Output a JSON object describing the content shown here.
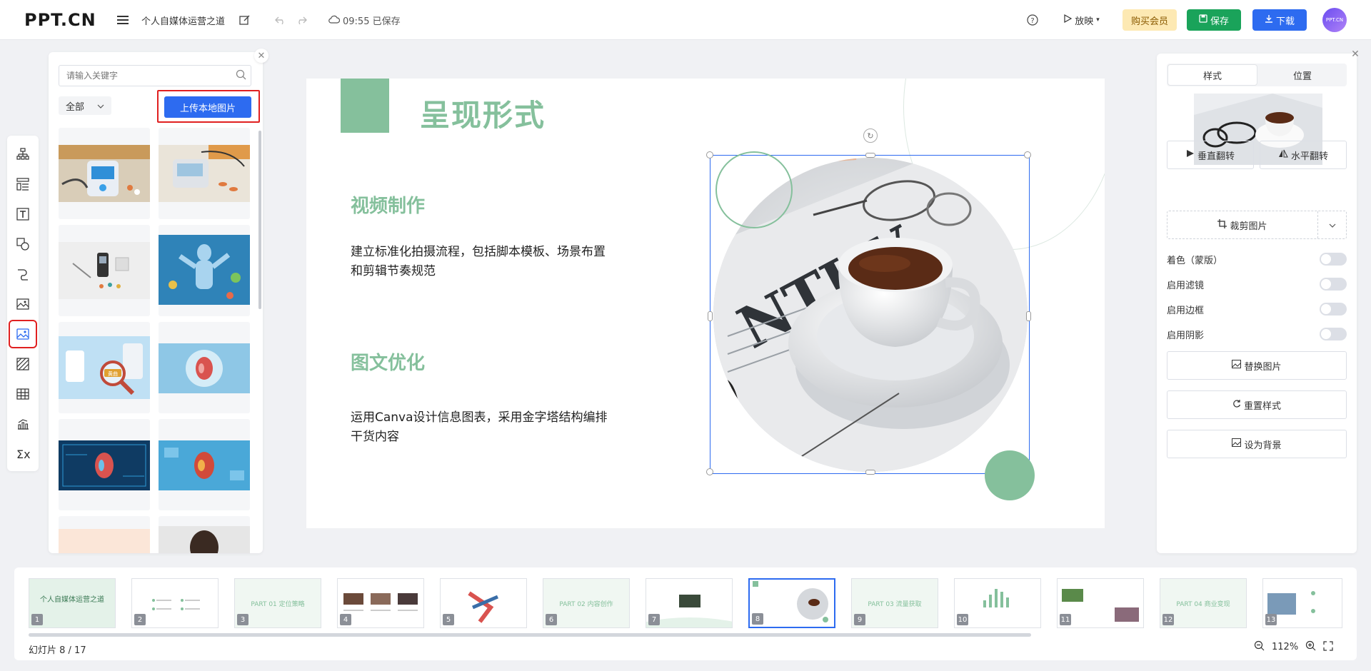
{
  "topbar": {
    "logo": "PPT.CN",
    "doc_title": "个人自媒体运营之道",
    "save_status": "09:55 已保存",
    "play_label": "放映",
    "vip_label": "购买会员",
    "save_label": "保存",
    "download_label": "下载",
    "avatar_text": "PPT.CN"
  },
  "image_panel": {
    "search_placeholder": "请输入关键字",
    "filter_label": "全部",
    "upload_label": "上传本地图片",
    "thumb_badge": "黄曲"
  },
  "slide": {
    "title": "呈现形式",
    "sections": [
      {
        "heading": "视频制作",
        "text": "建立标准化拍摄流程，包括脚本模板、场景布置和剪辑节奏规范"
      },
      {
        "heading": "图文优化",
        "text": "运用Canva设计信息图表，采用金字塔结构编排干货内容"
      }
    ],
    "newspaper_text": "NTUV"
  },
  "right_panel": {
    "tabs": [
      "样式",
      "位置"
    ],
    "flip_vertical": "垂直翻转",
    "flip_horizontal": "水平翻转",
    "crop_label": "裁剪图片",
    "toggles": [
      "着色（蒙版）",
      "启用滤镜",
      "启用边框",
      "启用阴影"
    ],
    "replace_label": "替换图片",
    "reset_label": "重置样式",
    "set_bg_label": "设为背景"
  },
  "filmstrip": {
    "thumbs": [
      {
        "num": "1",
        "caption": "个人自媒体运营之道"
      },
      {
        "num": "2",
        "caption": ""
      },
      {
        "num": "3",
        "caption": "PART 01 定位策略"
      },
      {
        "num": "4",
        "caption": ""
      },
      {
        "num": "5",
        "caption": ""
      },
      {
        "num": "6",
        "caption": "PART 02 内容创作"
      },
      {
        "num": "7",
        "caption": ""
      },
      {
        "num": "8",
        "caption": ""
      },
      {
        "num": "9",
        "caption": "PART 03 流量获取"
      },
      {
        "num": "10",
        "caption": ""
      },
      {
        "num": "11",
        "caption": ""
      },
      {
        "num": "12",
        "caption": "PART 04 商业变现"
      },
      {
        "num": "13",
        "caption": ""
      }
    ],
    "counter": "幻灯片 8 / 17",
    "zoom": "112%"
  },
  "colors": {
    "accent_green": "#85c09c",
    "primary_blue": "#2d6bf0",
    "save_green": "#1aa35a",
    "highlight_red": "#e02020"
  }
}
